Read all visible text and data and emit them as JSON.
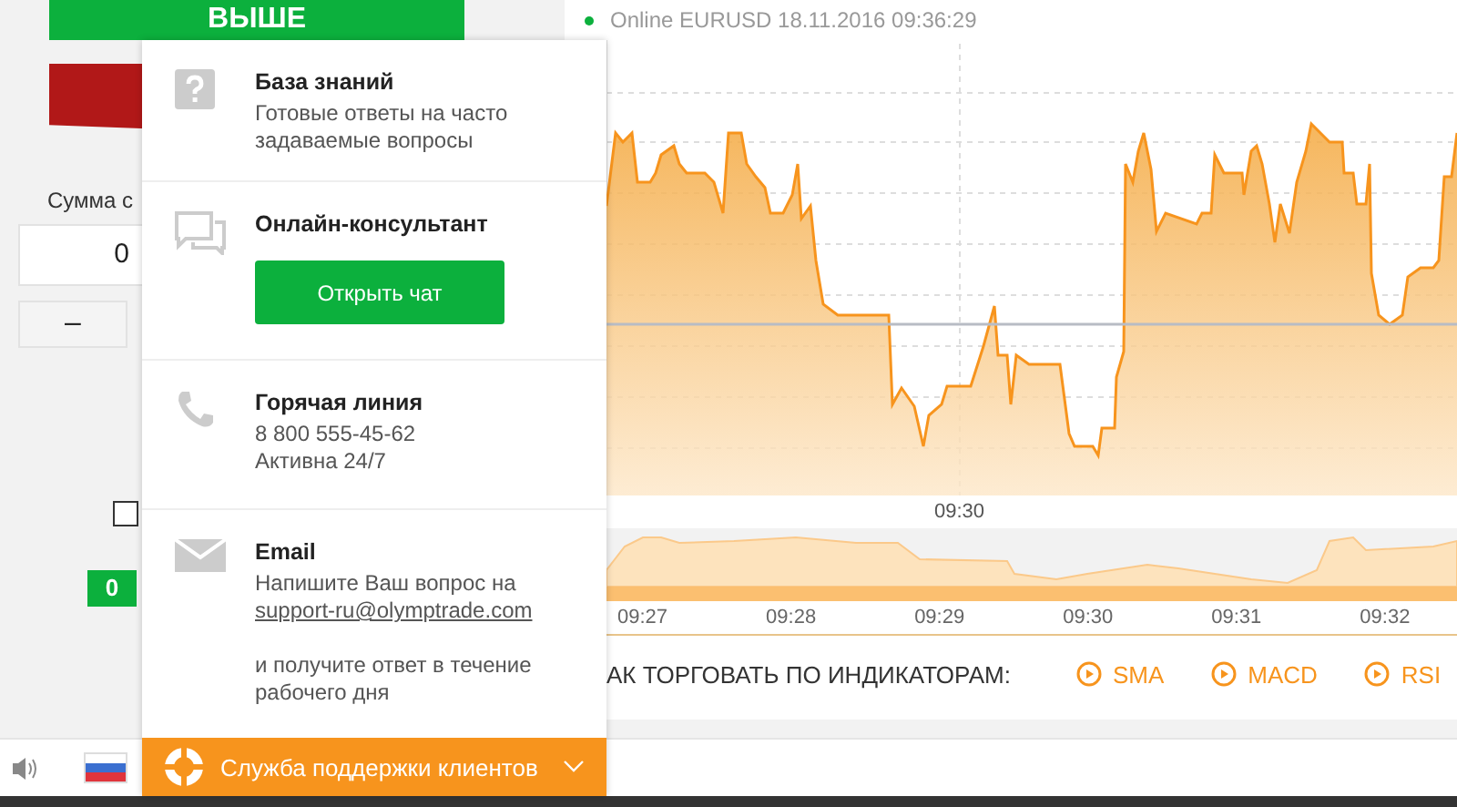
{
  "trade_panel": {
    "up_button": "ВЫШЕ",
    "amount_label": "Сумма с",
    "amount_value": "0",
    "minus_button": "–",
    "checkbox": {
      "checked": false
    },
    "badge": "0"
  },
  "chart_header": {
    "online": true,
    "text": "Online EURUSD 18.11.2016 09:36:29"
  },
  "chart": {
    "x_label": "09:30",
    "navigator_ticks": [
      "09:27",
      "09:28",
      "09:29",
      "09:30",
      "09:31",
      "09:32"
    ]
  },
  "indicators": {
    "title": "АК ТОРГОВАТЬ ПО ИНДИКАТОРАМ:",
    "items": [
      "SMA",
      "MACD",
      "RSI"
    ]
  },
  "support_popup": {
    "expanded": true,
    "sections": [
      {
        "kind": "knowledge",
        "title": "База знаний",
        "lines": [
          "Готовые ответы на часто задаваемые вопросы"
        ]
      },
      {
        "kind": "chat",
        "title": "Онлайн-консультант",
        "button": "Открыть чат"
      },
      {
        "kind": "phone",
        "title": "Горячая линия",
        "lines": [
          "8 800 555-45-62",
          "Активна 24/7"
        ]
      },
      {
        "kind": "email",
        "title": "Email",
        "lines": [
          "Напишите Ваш вопрос на"
        ],
        "link": "support-ru@olymptrade.com",
        "note": "и получите ответ в течение рабочего дня"
      }
    ],
    "footer": "Служба поддержки клиентов"
  }
}
